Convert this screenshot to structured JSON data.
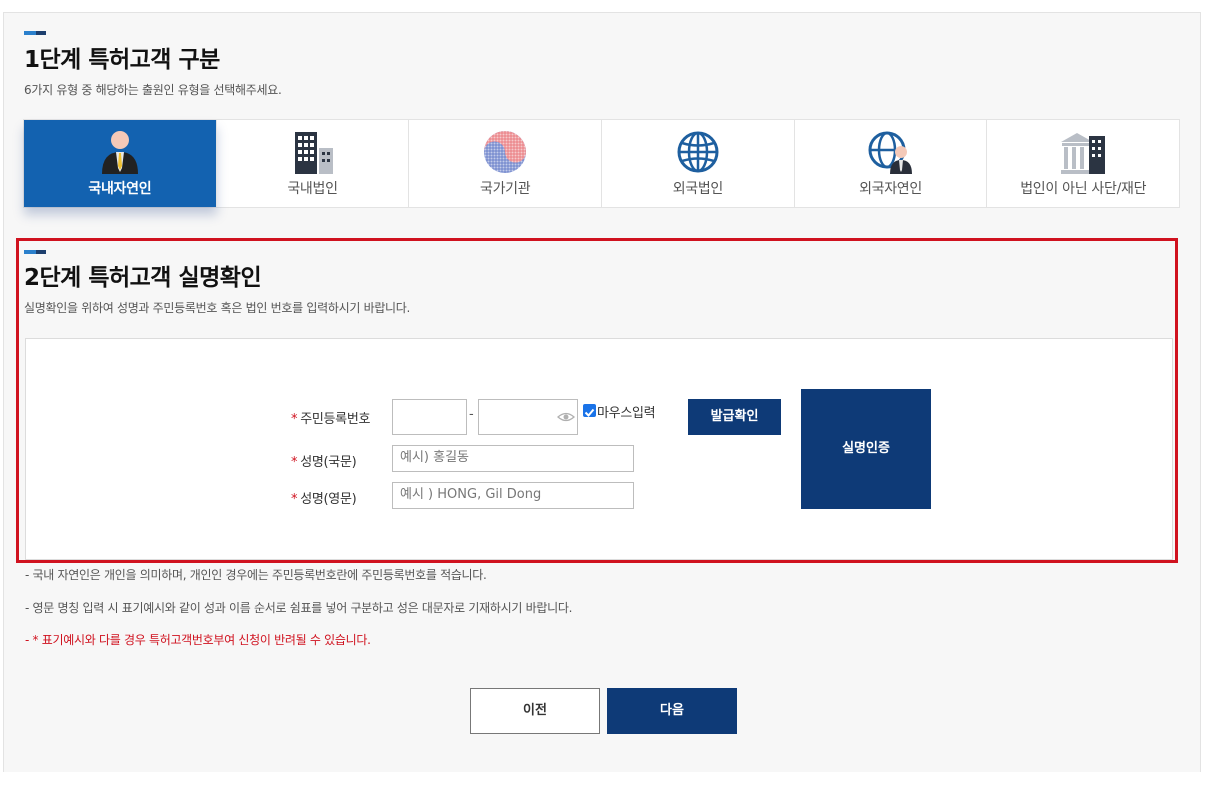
{
  "step1": {
    "title": "1단계 특허고객 구분",
    "subtitle": "6가지 유형 중 해당하는 출원인 유형을 선택해주세요.",
    "tabs": [
      {
        "label": "국내자연인",
        "icon": "person-icon",
        "active": true
      },
      {
        "label": "국내법인",
        "icon": "building-icon",
        "active": false
      },
      {
        "label": "국가기관",
        "icon": "taegeuk-icon",
        "active": false
      },
      {
        "label": "외국법인",
        "icon": "globe-icon",
        "active": false
      },
      {
        "label": "외국자연인",
        "icon": "globe-person-icon",
        "active": false
      },
      {
        "label": "법인이 아닌 사단/재단",
        "icon": "institution-icon",
        "active": false
      }
    ]
  },
  "step2": {
    "title": "2단계 특허고객 실명확인",
    "subtitle": "실명확인을 위하여 성명과 주민등록번호 혹은 법인 번호를 입력하시기 바랍니다.",
    "form": {
      "rrn_label": "주민등록번호",
      "rrn_front_value": "",
      "rrn_back_value": "",
      "rrn_separator": "-",
      "mouse_input_label": "마우스입력",
      "mouse_input_checked": true,
      "issue_check_button": "발급확인",
      "name_kor_label": "성명(국문)",
      "name_kor_placeholder": "예시) 홍길동",
      "name_eng_label": "성명(영문)",
      "name_eng_placeholder": "예시 ) HONG, Gil Dong",
      "verify_button": "실명인증",
      "required_mark": "*"
    }
  },
  "notes": [
    "- 국내 자연인은 개인을 의미하며, 개인인 경우에는 주민등록번호란에 주민등록번호를 적습니다.",
    "- 영문 명칭 입력 시 표기예시와 같이 성과 이름 순서로 쉼표를 넣어 구분하고 성은 대문자로 기재하시기 바랍니다.",
    "- * 표기예시와 다를 경우 특허고객번호부여 신청이 반려될 수 있습니다."
  ],
  "nav": {
    "prev": "이전",
    "next": "다음"
  },
  "colors": {
    "active_tab": "#1362b0",
    "navy_button": "#0e3a77",
    "highlight_box": "#d0121f"
  }
}
